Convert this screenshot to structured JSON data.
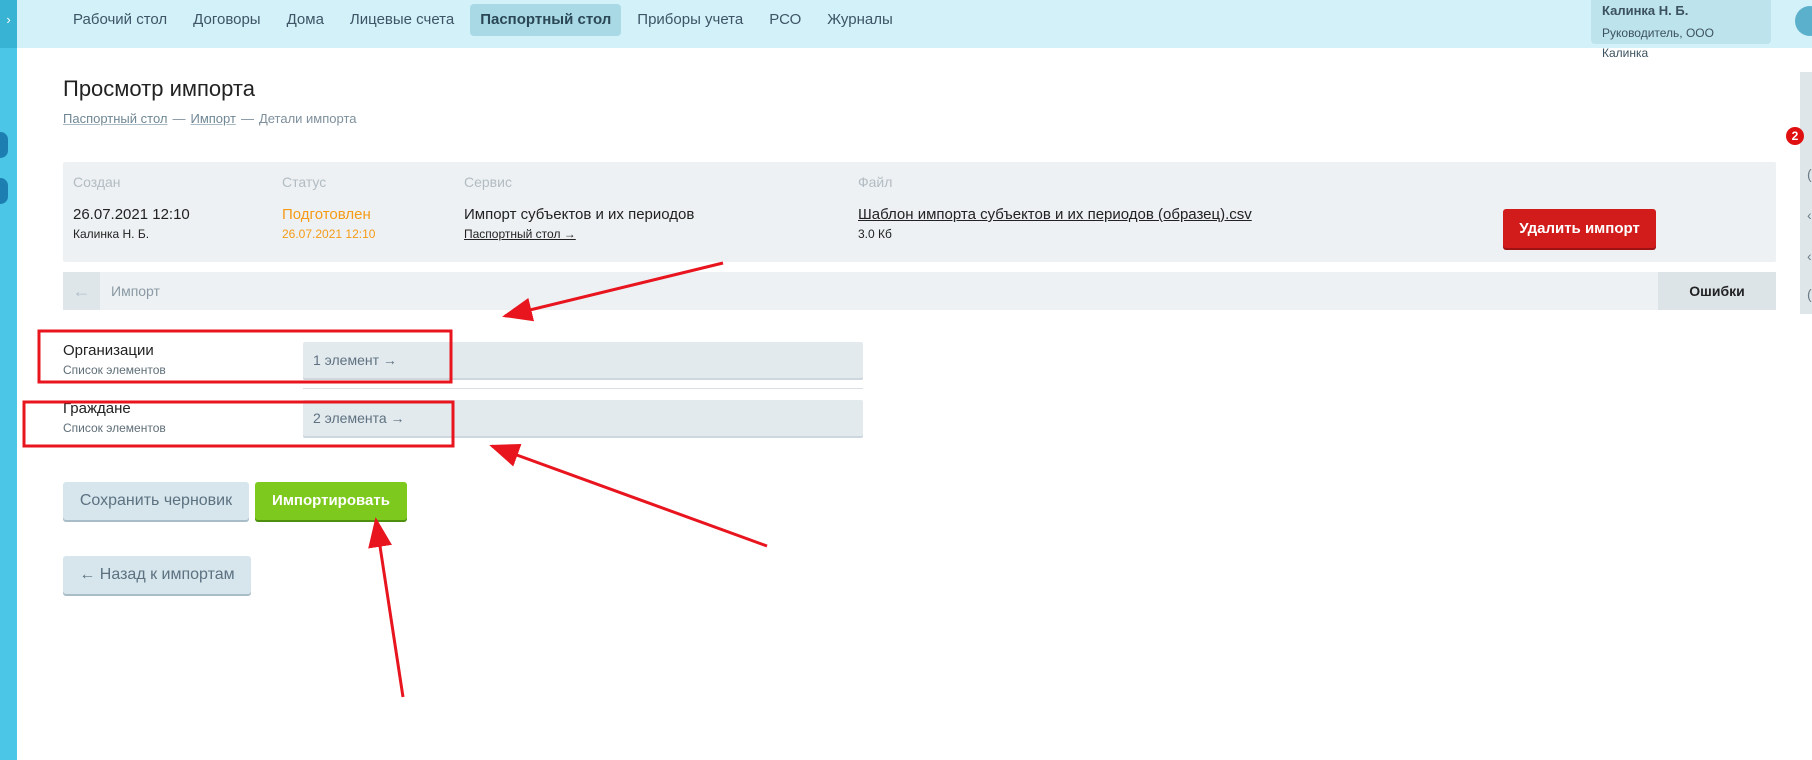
{
  "nav": {
    "items": [
      {
        "label": "Рабочий стол",
        "active": false
      },
      {
        "label": "Договоры",
        "active": false
      },
      {
        "label": "Дома",
        "active": false
      },
      {
        "label": "Лицевые счета",
        "active": false
      },
      {
        "label": "Паспортный стол",
        "active": true
      },
      {
        "label": "Приборы учета",
        "active": false
      },
      {
        "label": "РСО",
        "active": false
      },
      {
        "label": "Журналы",
        "active": false
      }
    ],
    "user_name": "Калинка Н. Б.",
    "user_role": "Руководитель, ООО Калинка",
    "notification_count": "2"
  },
  "page": {
    "title": "Просмотр импорта",
    "breadcrumb": {
      "items": [
        "Паспортный стол",
        "Импорт",
        "Детали импорта"
      ],
      "separator": "—"
    }
  },
  "info": {
    "created_head": "Создан",
    "created_date": "26.07.2021 12:10",
    "created_by": "Калинка Н. Б.",
    "status_head": "Статус",
    "status_value": "Подготовлен",
    "status_date": "26.07.2021 12:10",
    "service_head": "Сервис",
    "service_value": "Импорт субъектов и их периодов",
    "service_link": "Паспортный стол →",
    "file_head": "Файл",
    "file_name": "Шаблон импорта субъектов и их периодов (образец).csv",
    "file_size": "3.0 Кб",
    "delete_label": "Удалить импорт"
  },
  "tabs": {
    "current": "Импорт",
    "errors": "Ошибки"
  },
  "rows": [
    {
      "title": "Организации",
      "subtitle": "Список элементов",
      "value": "1 элемент →"
    },
    {
      "title": "Граждане",
      "subtitle": "Список элементов",
      "value": "2 элемента →"
    }
  ],
  "actions": {
    "save_draft": "Сохранить черновик",
    "import": "Импортировать",
    "back": "← Назад к импортам"
  },
  "colors": {
    "accent_topbar": "#d3f1f8",
    "status_orange": "#f59b16",
    "delete_red": "#d21c1c",
    "import_green": "#7ec91e",
    "annotation_red": "#e8141e"
  }
}
